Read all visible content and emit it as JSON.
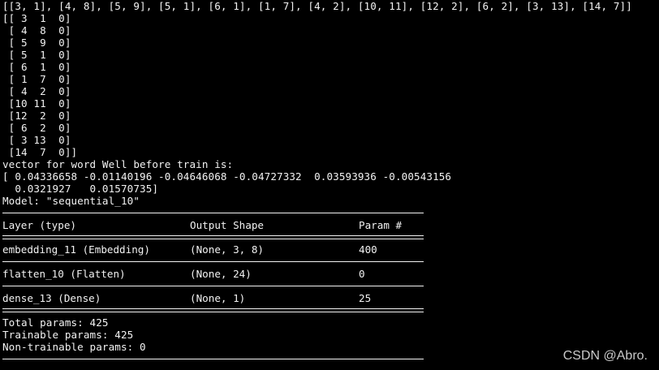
{
  "top_array_line": "[[3, 1], [4, 8], [5, 9], [5, 1], [6, 1], [1, 7], [4, 2], [10, 11], [12, 2], [6, 2], [3, 13], [14, 7]]",
  "np_array_lines": [
    "[[ 3  1  0]",
    " [ 4  8  0]",
    " [ 5  9  0]",
    " [ 5  1  0]",
    " [ 6  1  0]",
    " [ 1  7  0]",
    " [ 4  2  0]",
    " [10 11  0]",
    " [12  2  0]",
    " [ 6  2  0]",
    " [ 3 13  0]",
    " [14  7  0]]"
  ],
  "vector_caption": "vector for word Well before train is:",
  "vector_lines": [
    "[ 0.04336658 -0.01140196 -0.04646068 -0.04727332  0.03593936 -0.00543156",
    "  0.0321927   0.01570735]"
  ],
  "model_line": "Model: \"sequential_10\"",
  "summary": {
    "header": {
      "layer": "Layer (type)",
      "shape": "Output Shape",
      "params": "Param #"
    },
    "rows": [
      {
        "layer": "embedding_11 (Embedding)",
        "shape": "(None, 3, 8)",
        "params": "400"
      },
      {
        "layer": "flatten_10 (Flatten)",
        "shape": "(None, 24)",
        "params": "0"
      },
      {
        "layer": "dense_13 (Dense)",
        "shape": "(None, 1)",
        "params": "25"
      }
    ],
    "total": "Total params: 425",
    "trainable": "Trainable params: 425",
    "non_trainable": "Non-trainable params: 0"
  },
  "watermark": "CSDN @Abro."
}
